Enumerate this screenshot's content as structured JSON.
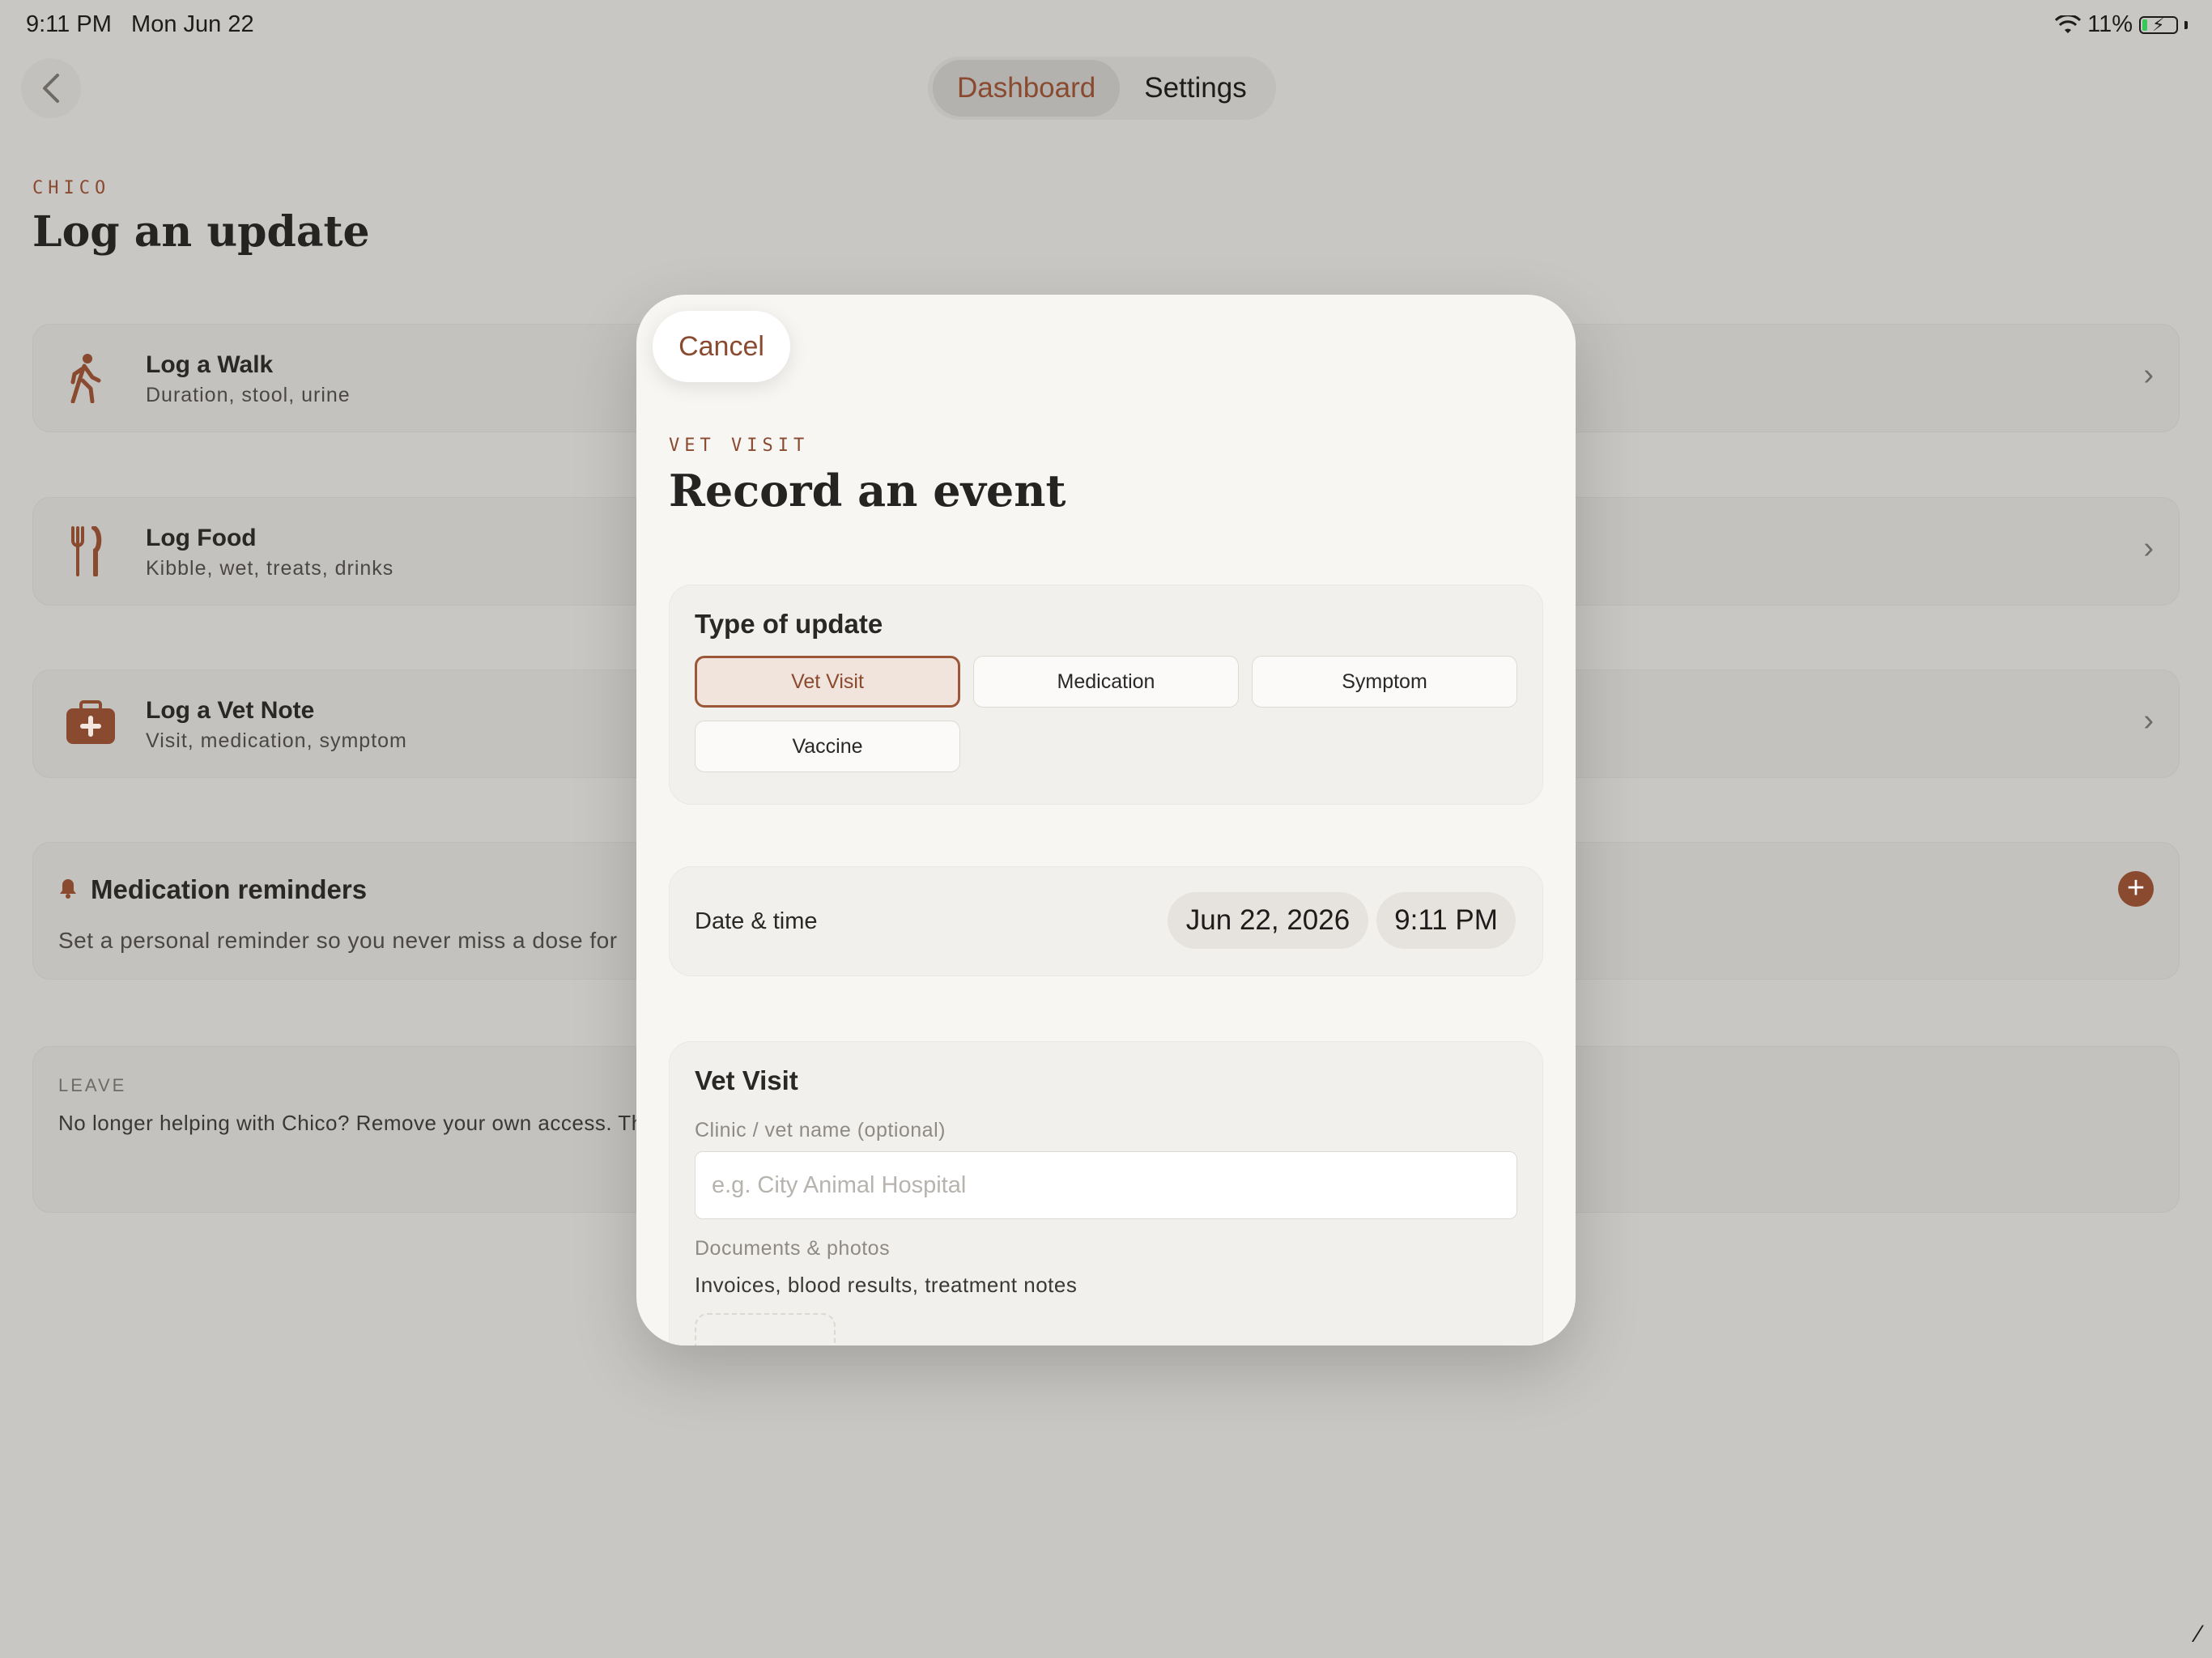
{
  "status_bar": {
    "time": "9:11 PM",
    "date": "Mon Jun 22",
    "battery": "11%"
  },
  "nav": {
    "tabs": [
      "Dashboard",
      "Settings"
    ],
    "active_tab": "Dashboard"
  },
  "page": {
    "eyebrow": "CHICO",
    "title": "Log an update"
  },
  "rows": [
    {
      "title": "Log a Walk",
      "subtitle": "Duration, stool, urine",
      "icon": "walk-icon"
    },
    {
      "title": "Log Food",
      "subtitle": "Kibble, wet, treats, drinks",
      "icon": "fork-knife-icon"
    },
    {
      "title": "Log a Vet Note",
      "subtitle": "Visit, medication, symptom",
      "icon": "medical-kit-icon"
    }
  ],
  "reminders": {
    "title": "Medication reminders",
    "subtitle": "Set a personal reminder so you never miss a dose for"
  },
  "leave": {
    "eyebrow": "LEAVE",
    "text": "No longer helping with Chico? Remove your own access. The"
  },
  "modal": {
    "cancel": "Cancel",
    "eyebrow": "VET VISIT",
    "title": "Record an event",
    "type_card": {
      "title": "Type of update",
      "options": [
        "Vet Visit",
        "Medication",
        "Symptom",
        "Vaccine"
      ],
      "selected": "Vet Visit"
    },
    "datetime": {
      "label": "Date & time",
      "date": "Jun 22, 2026",
      "time": "9:11 PM"
    },
    "vet_card": {
      "title": "Vet Visit",
      "clinic_label": "Clinic / vet name (optional)",
      "clinic_placeholder": "e.g. City Animal Hospital",
      "docs_label": "Documents & photos",
      "docs_sub": "Invoices, blood results, treatment notes"
    }
  },
  "colors": {
    "accent": "#8a4a30",
    "backdrop": "#c8c7c4",
    "sheet": "#f8f6f3"
  }
}
